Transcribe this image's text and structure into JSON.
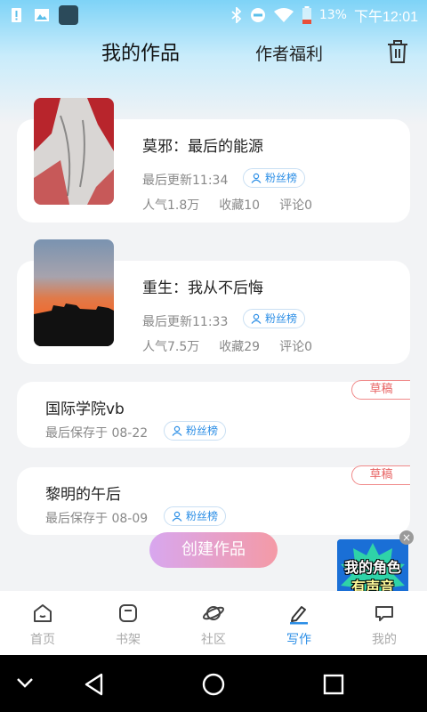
{
  "status": {
    "battery_pct": "13%",
    "time": "下午12:01"
  },
  "header": {
    "title": "我的作品",
    "welfare": "作者福利"
  },
  "works": [
    {
      "title": "莫邪：最后的能源",
      "updated": "最后更新11:34",
      "fans_label": "粉丝榜",
      "popularity": "人气1.8万",
      "favorites": "收藏10",
      "comments": "评论0"
    },
    {
      "title": "重生：我从不后悔",
      "updated": "最后更新11:33",
      "fans_label": "粉丝榜",
      "popularity": "人气7.5万",
      "favorites": "收藏29",
      "comments": "评论0"
    }
  ],
  "drafts": [
    {
      "title": "国际学院vb",
      "saved": "最后保存于 08-22",
      "fans_label": "粉丝榜",
      "tag": "草稿"
    },
    {
      "title": "黎明的午后",
      "saved": "最后保存于 08-09",
      "fans_label": "粉丝榜",
      "tag": "草稿"
    }
  ],
  "create_button": "创建作品",
  "promo": {
    "line1": "我的角色",
    "line2": "有声音"
  },
  "bottom_nav": [
    {
      "label": "首页",
      "icon": "home-icon"
    },
    {
      "label": "书架",
      "icon": "bookshelf-icon"
    },
    {
      "label": "社区",
      "icon": "planet-icon"
    },
    {
      "label": "写作",
      "icon": "pen-icon",
      "active": true
    },
    {
      "label": "我的",
      "icon": "profile-icon"
    }
  ],
  "colors": {
    "accent": "#2b8ee6",
    "draft_tag": "#e86464",
    "header_gradient_top": "#7ed3f7"
  }
}
